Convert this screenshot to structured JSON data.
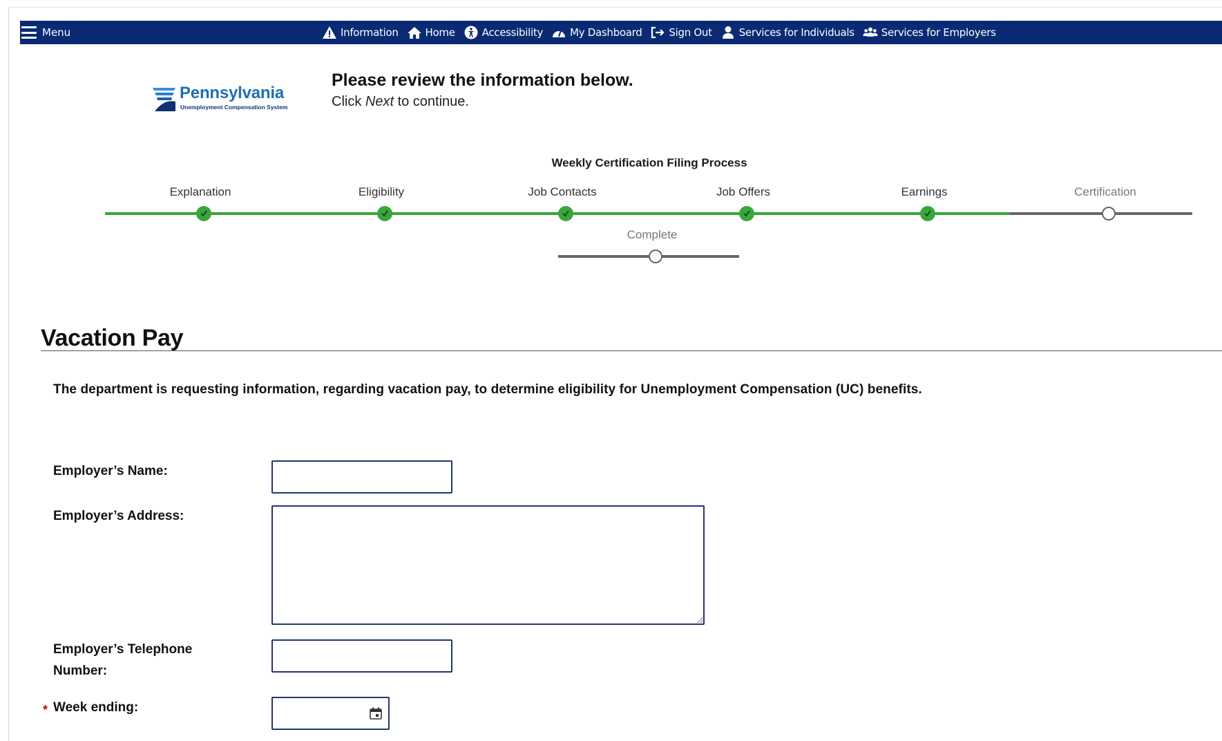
{
  "nav": {
    "menu_label": "Menu",
    "links": [
      {
        "label": "Information",
        "icon": "warning-icon"
      },
      {
        "label": "Home",
        "icon": "home-icon"
      },
      {
        "label": "Accessibility",
        "icon": "accessibility-icon"
      },
      {
        "label": "My Dashboard",
        "icon": "dashboard-icon"
      },
      {
        "label": "Sign Out",
        "icon": "sign-out-icon"
      },
      {
        "label": "Services for Individuals",
        "icon": "person-icon"
      },
      {
        "label": "Services for Employers",
        "icon": "group-icon"
      }
    ]
  },
  "logo": {
    "name": "Pennsylvania",
    "subtitle": "Unemployment Compensation System"
  },
  "header": {
    "title": "Please review the information below.",
    "subtitle_prefix": "Click ",
    "subtitle_emphasis": "Next",
    "subtitle_suffix": " to continue."
  },
  "progress": {
    "title": "Weekly Certification Filing Process",
    "steps": [
      {
        "label": "Explanation",
        "status": "done"
      },
      {
        "label": "Eligibility",
        "status": "done"
      },
      {
        "label": "Job Contacts",
        "status": "done"
      },
      {
        "label": "Job Offers",
        "status": "done"
      },
      {
        "label": "Earnings",
        "status": "done"
      },
      {
        "label": "Certification",
        "status": "pending"
      },
      {
        "label": "Complete",
        "status": "pending"
      }
    ]
  },
  "section": {
    "title": "Vacation Pay",
    "intro": "The department is requesting information, regarding vacation pay, to determine eligibility for Unemployment Compensation (UC) benefits."
  },
  "form": {
    "employer_name_label": "Employer’s Name:",
    "employer_name_value": "",
    "employer_address_label": "Employer’s Address:",
    "employer_address_value": "",
    "employer_phone_label_line1": "Employer’s Telephone",
    "employer_phone_label_line2": "Number:",
    "employer_phone_value": "",
    "week_ending_required": "*",
    "week_ending_label": "Week ending:",
    "week_ending_value": ""
  },
  "colors": {
    "nav_bg": "#0b2a74",
    "progress_done": "#38a53a",
    "progress_pending": "#666666",
    "input_border": "#24356e",
    "required": "#d10000"
  }
}
